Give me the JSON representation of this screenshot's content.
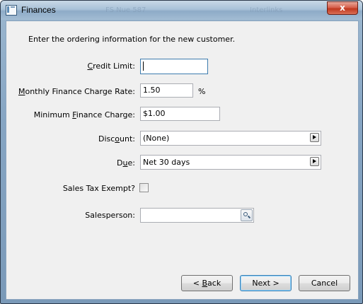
{
  "window": {
    "title": "Finances",
    "close_label": "x",
    "bg_ghost": [
      "FS Nue 587",
      "Interlinks"
    ]
  },
  "form": {
    "instructions": "Enter the ordering information for the new customer.",
    "credit_limit": {
      "pre": "",
      "key": "C",
      "post": "redit Limit:",
      "value": ""
    },
    "finance_rate": {
      "pre": "",
      "key": "M",
      "post": "onthly Finance Charge Rate:",
      "value": "1.50",
      "unit": "%"
    },
    "min_charge": {
      "pre": "Minimum ",
      "key": "F",
      "post": "inance Charge:",
      "value": "$1.00"
    },
    "discount": {
      "pre": "Disc",
      "key": "o",
      "post": "unt:",
      "value": "(None)"
    },
    "due": {
      "pre": "D",
      "key": "u",
      "post": "e:",
      "value": "Net  30 days"
    },
    "sales_tax": {
      "label": "Sales Tax Exempt?",
      "checked": false
    },
    "salesperson": {
      "label": "Salesperson:",
      "value": ""
    }
  },
  "buttons": {
    "back": {
      "pre": "< ",
      "key": "B",
      "post": "ack"
    },
    "next": "Next >",
    "cancel": "Cancel"
  },
  "colors": {
    "accent": "#3d7bad",
    "close": "#c0381f",
    "client_bg": "#f0f0f0"
  }
}
